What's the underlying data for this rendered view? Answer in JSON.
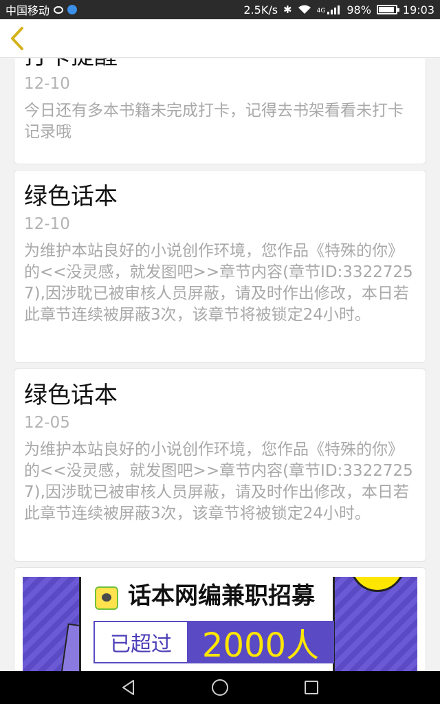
{
  "status_bar": {
    "carrier": "中国移动",
    "net_speed": "2.5K/s",
    "signal_label": "4G",
    "battery": "98%",
    "time": "19:03"
  },
  "header": {
    "back_icon": "chevron-left-icon",
    "accent_color": "#d4b21a"
  },
  "notifications": [
    {
      "title": "打卡提醒",
      "date": "12-10",
      "body": "今日还有多本书籍未完成打卡，记得去书架看看未打卡记录哦"
    },
    {
      "title": "绿色话本",
      "date": "12-10",
      "body": "为维护本站良好的小说创作环境，您作品《特殊的你》的<<没灵感，就发图吧>>章节内容(章节ID:33227257),因涉耽已被审核人员屏蔽，请及时作出修改，本日若此章节连续被屏蔽3次，该章节将被锁定24小时。"
    },
    {
      "title": "绿色话本",
      "date": "12-05",
      "body": "为维护本站良好的小说创作环境，您作品《特殊的你》的<<没灵感，就发图吧>>章节内容(章节ID:33227257),因涉耽已被审核人员屏蔽，请及时作出修改，本日若此章节连续被屏蔽3次，该章节将被锁定24小时。"
    }
  ],
  "banner": {
    "title": "话本网编兼职招募",
    "left_text": "已超过",
    "right_text": "2000人",
    "colors": {
      "purple": "#5a4bc4",
      "yellow": "#ffe600"
    }
  },
  "nav_bar": {
    "buttons": [
      "back-triangle-icon",
      "home-circle-icon",
      "recents-square-icon"
    ]
  }
}
